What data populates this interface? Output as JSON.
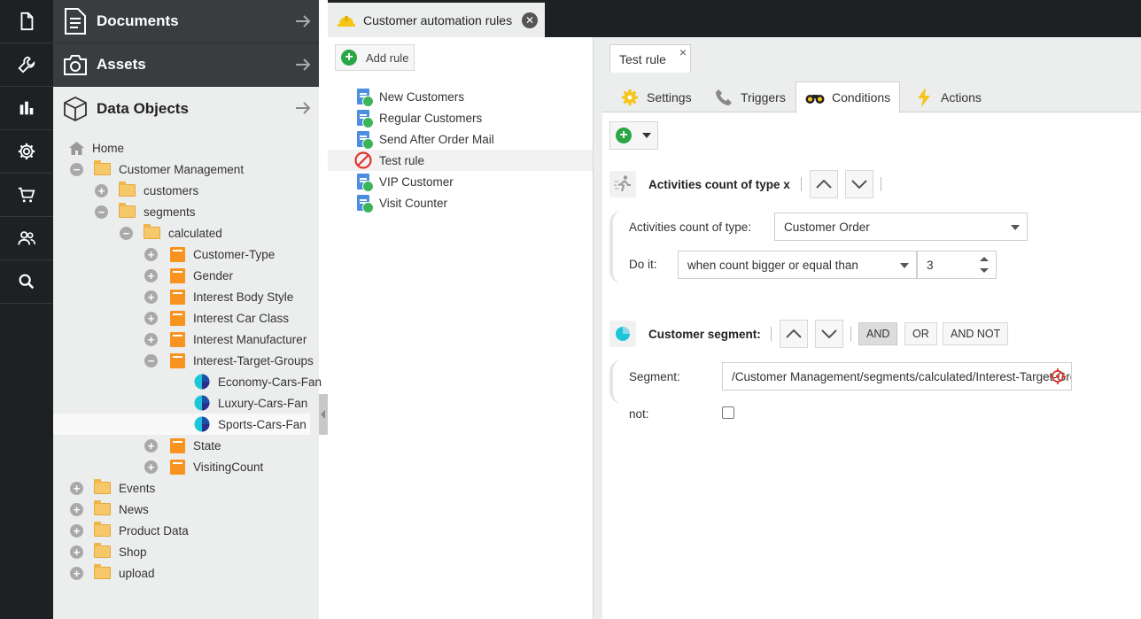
{
  "app": {
    "accent_color": "#3cb55a",
    "sidebar_icons": [
      "document-icon",
      "wrench-icon",
      "chart-icon",
      "gear-icon",
      "cart-icon",
      "users-icon",
      "search-icon"
    ]
  },
  "panels": {
    "documents": "Documents",
    "assets": "Assets",
    "data_objects": "Data Objects"
  },
  "tree": {
    "home": "Home",
    "customer_management": "Customer Management",
    "customers": "customers",
    "segments": "segments",
    "calculated": "calculated",
    "customer_type": "Customer-Type",
    "gender": "Gender",
    "interest_body_style": "Interest Body Style",
    "interest_car_class": "Interest Car Class",
    "interest_manufacturer": "Interest Manufacturer",
    "interest_target_groups": "Interest-Target-Groups",
    "economy_cars_fan": "Economy-Cars-Fan",
    "luxury_cars_fan": "Luxury-Cars-Fan",
    "sports_cars_fan": "Sports-Cars-Fan",
    "state": "State",
    "visiting_count": "VisitingCount",
    "events": "Events",
    "news": "News",
    "product_data": "Product Data",
    "shop": "Shop",
    "upload": "upload"
  },
  "main_tab": {
    "label": "Customer automation rules"
  },
  "rules": {
    "add_label": "Add rule",
    "items": [
      "New Customers",
      "Regular Customers",
      "Send After Order Mail",
      "Test rule",
      "VIP Customer",
      "Visit Counter"
    ]
  },
  "editor": {
    "tab_label": "Test rule",
    "tab_close": "×",
    "subtabs": {
      "settings": "Settings",
      "triggers": "Triggers",
      "conditions": "Conditions",
      "actions": "Actions"
    },
    "condition1": {
      "title": "Activities count of type x",
      "type_label": "Activities count of type:",
      "type_value": "Customer Order",
      "doit_label": "Do it:",
      "doit_value": "when count bigger or equal than",
      "count_value": "3"
    },
    "condition2": {
      "title": "Customer segment:",
      "op_and": "AND",
      "op_or": "OR",
      "op_and_not": "AND NOT",
      "segment_label": "Segment:",
      "segment_value": "/Customer Management/segments/calculated/Interest-Target-Groups/Sports-Cars-Fan",
      "not_label": "not:"
    }
  }
}
